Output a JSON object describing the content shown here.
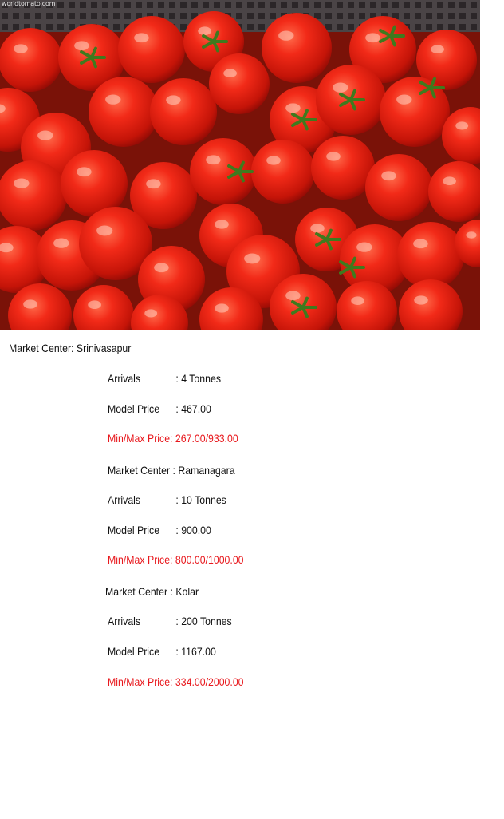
{
  "image": {
    "alt_icon": "tomatoes-photo",
    "watermark": "worldtomato.com"
  },
  "first_market": {
    "label": "Market Center: Srinivasapur"
  },
  "blocks": [
    {
      "arrivals_label": "Arrivals",
      "arrivals_value": ": 4 Tonnes",
      "model_label": "Model Price",
      "model_value": ": 467.00",
      "minmax": "Min/Max Price: 267.00/933.00"
    },
    {
      "market": "Market Center : Ramanagara",
      "arrivals_label": "Arrivals",
      "arrivals_value": ": 10 Tonnes",
      "model_label": "Model Price",
      "model_value": ": 900.00",
      "minmax": "Min/Max Price: 800.00/1000.00"
    },
    {
      "market": "Market Center : Kolar",
      "arrivals_label": "Arrivals",
      "arrivals_value": ": 200 Tonnes",
      "model_label": "Model Price",
      "model_value": ": 1167.00",
      "minmax": "Min/Max Price: 334.00/2000.00"
    }
  ],
  "colors": {
    "text": "#111111",
    "price_range": "#e8171c",
    "tomato": "#e02015"
  }
}
